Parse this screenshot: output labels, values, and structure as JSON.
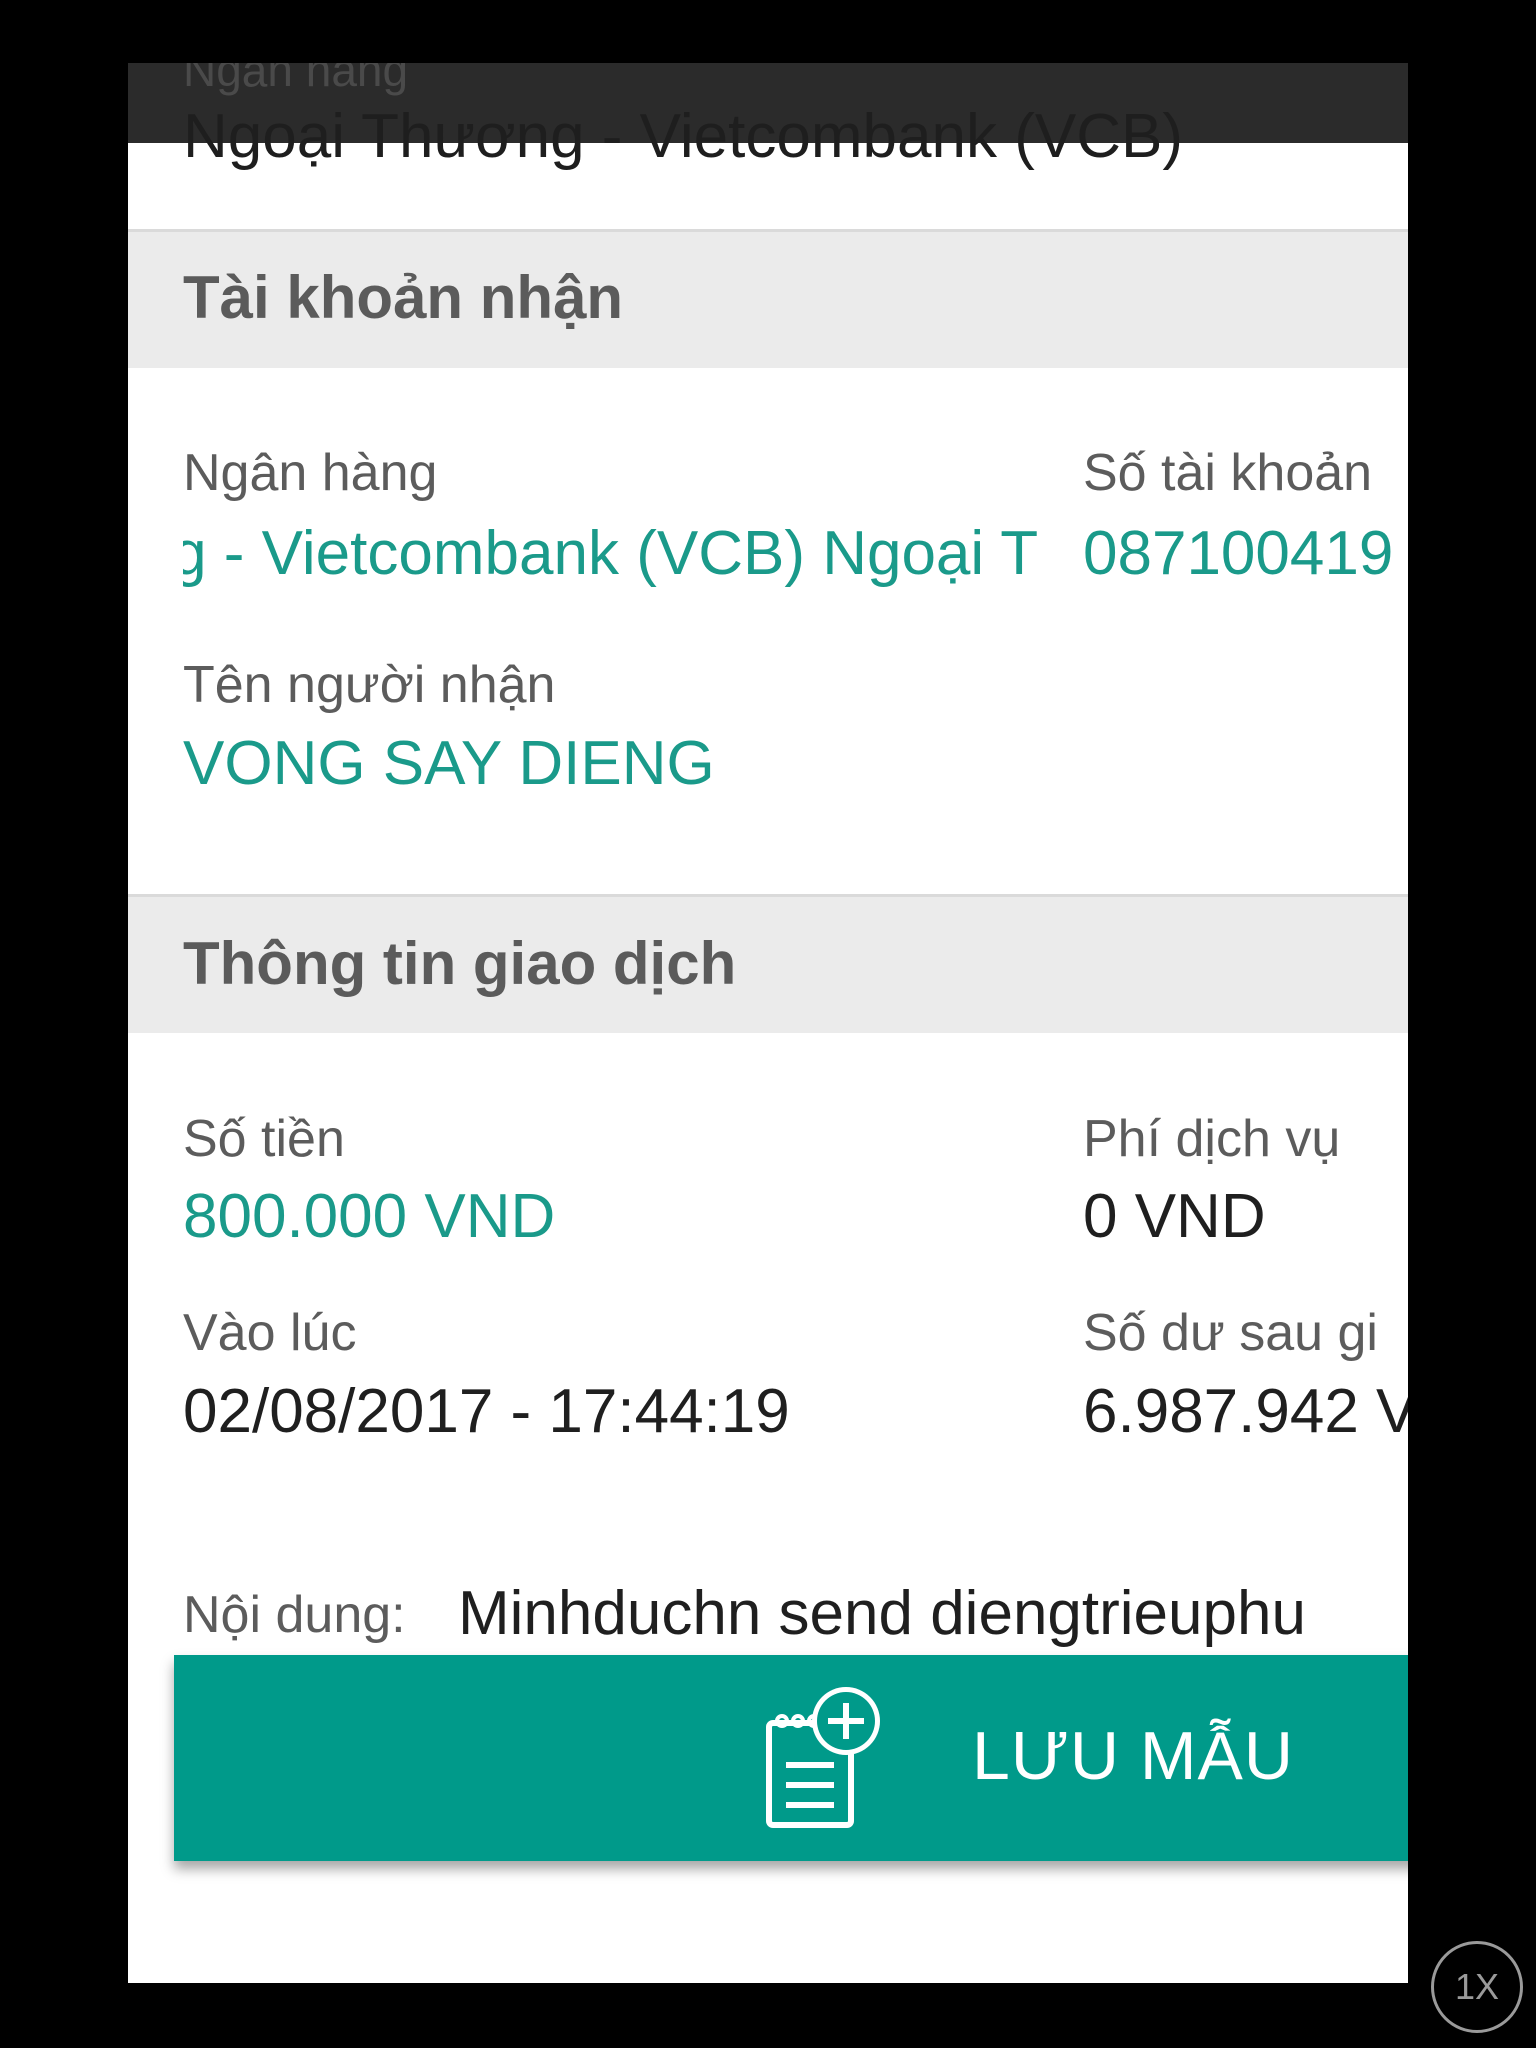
{
  "header": {
    "bank_label": "Ngân hàng",
    "bank_name": "Ngoại Thương - Vietcombank (VCB)"
  },
  "recipient": {
    "section_title": "Tài khoản nhận",
    "bank_label": "Ngân hàng",
    "bank_value_scrolling": "Ngoại Thương - Vietcombank (VCB)   Ngoại T",
    "account_label": "Số tài khoản",
    "account_value": "087100419",
    "name_label": "Tên người nhận",
    "name_value": "VONG SAY DIENG"
  },
  "transaction": {
    "section_title": "Thông tin giao dịch",
    "amount_label": "Số tiền",
    "amount_value": "800.000 VND",
    "fee_label": "Phí dịch vụ",
    "fee_value": "0 VND",
    "time_label": "Vào lúc",
    "time_value": "02/08/2017 - 17:44:19",
    "balance_label": "Số dư sau gi",
    "balance_value": "6.987.942 V",
    "content_label": "Nội dung:",
    "content_value": "Minhduchn send diengtrieuphu"
  },
  "actions": {
    "save_template_label": "LƯU MẪU"
  },
  "player": {
    "speed_label": "1X"
  },
  "colors": {
    "accent_teal": "#009a8a",
    "value_teal": "#1a9a8a",
    "section_bg": "#ebebeb"
  },
  "icons": {
    "save_template": "notepad-plus-icon"
  }
}
